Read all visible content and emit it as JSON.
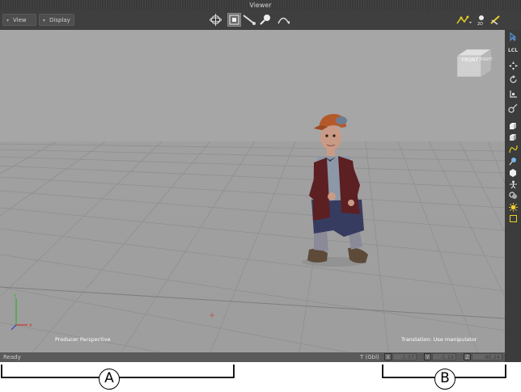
{
  "window": {
    "title": "Viewer"
  },
  "toolbar": {
    "view_menu": "View",
    "display_menu": "Display",
    "tools": [
      "orbit-icon",
      "translate-icon",
      "brush-icon",
      "zoom-icon",
      "arc-icon"
    ],
    "right_tools": [
      "graph-icon",
      "2d-icon",
      "pen-icon"
    ],
    "right_badge": "2D"
  },
  "viewport": {
    "camera_label": "Producer Perspective",
    "manipulator_hint": "Translation: Use manipulator",
    "cube_front": "FRONT",
    "cube_right": "RIGHT",
    "background": "#a6a6a6"
  },
  "right_toolbar": {
    "items": [
      "pointer-icon",
      "lcl-label",
      "move-icon",
      "rotate-icon",
      "scale-icon",
      "manipulator-icon",
      "cube-icon",
      "cube-shaded-icon",
      "curve-icon",
      "light-icon",
      "sphere-icon",
      "skeleton-icon",
      "camera-icon",
      "sun-icon",
      "frame-icon"
    ],
    "lcl_label": "LCL"
  },
  "status": {
    "text": "Ready",
    "transform_label": "T (Gbl)",
    "x_label": "X",
    "x_value": "-1.37",
    "y_label": "Y",
    "y_value": "-1.19",
    "z_label": "Z",
    "z_value": "-90.24"
  },
  "callouts": {
    "a_label": "A",
    "b_label": "B"
  }
}
